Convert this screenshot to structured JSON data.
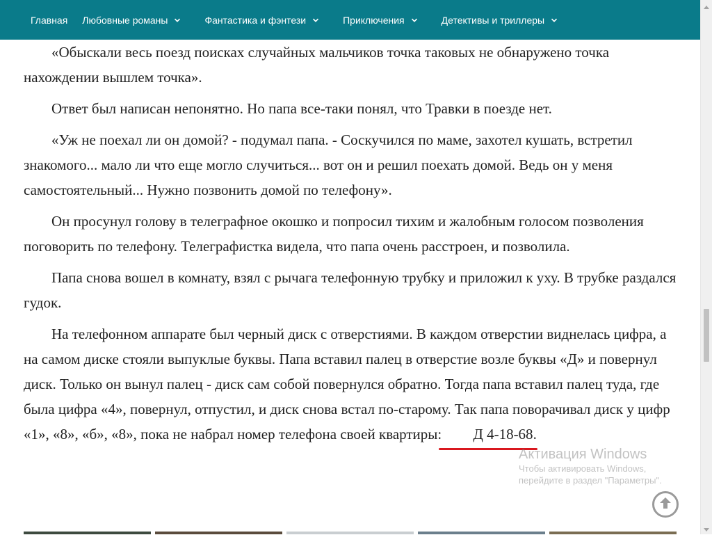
{
  "nav": {
    "items": [
      {
        "label": "Главная",
        "dropdown": false
      },
      {
        "label": "Любовные романы",
        "dropdown": true
      },
      {
        "label": "Фантастика и фэнтези",
        "dropdown": true
      },
      {
        "label": "Приключения",
        "dropdown": true
      },
      {
        "label": "Детективы и триллеры",
        "dropdown": true
      }
    ]
  },
  "article": {
    "p1": "«Обыскали весь поезд поисках случайных мальчиков точка таковых не обнаружено точка нахождении вышлем точка».",
    "p2": "Ответ был написан непонятно. Но папа все-таки понял, что Травки в поезде нет.",
    "p3": "«Уж не поехал ли он домой? - подумал папа. - Соскучился по маме, захотел кушать, встретил знакомого... мало ли что еще могло случиться... вот он и решил поехать домой. Ведь он у меня самостоятельный... Нужно позвонить домой по телефону».",
    "p4": "Он просунул голову в телеграфное окошко и попросил тихим и жалобным голосом позволения поговорить по телефону. Телеграфистка видела, что папа очень расстроен, и позволила.",
    "p5": "Папа снова вошел в комнату, взял с рычага телефонную трубку и приложил к уху. В трубке раздался гудок.",
    "p6_text": "На телефонном аппарате был черный диск с отверстиями. В каждом отверстии виднелась цифра, а на самом диске стояли выпуклые буквы. Папа вставил палец в отверстие возле буквы «Д» и повернул диск. Только он вынул палец - диск сам собой повернулся обратно. Тогда папа вставил палец туда, где была цифра «4», повернул, отпустил, и диск снова встал по-старому. Так папа поворачивал диск у цифр «1», «8», «б», «8», пока не набрал номер телефона своей квартиры: ",
    "phone": "Д 4-18-68",
    "p6_end": "."
  },
  "watermark": {
    "title": "Активация Windows",
    "line1": "Чтобы активировать Windows,",
    "line2": "перейдите в раздел \"Параметры\"."
  },
  "colors": {
    "nav_bg": "#0a7b8a",
    "text": "#222222",
    "underline": "#d9181f",
    "thumb_1": "#3d4a3f",
    "thumb_2": "#5a4b3c",
    "thumb_3": "#c9ced1",
    "thumb_4": "#6b7f8c",
    "thumb_5": "#7a6d52"
  },
  "icons": {
    "chevron": "chevron-down-icon",
    "scroll_top": "arrow-up-circle-icon",
    "scroll_up": "triangle-up-icon",
    "scroll_down": "triangle-down-icon"
  }
}
